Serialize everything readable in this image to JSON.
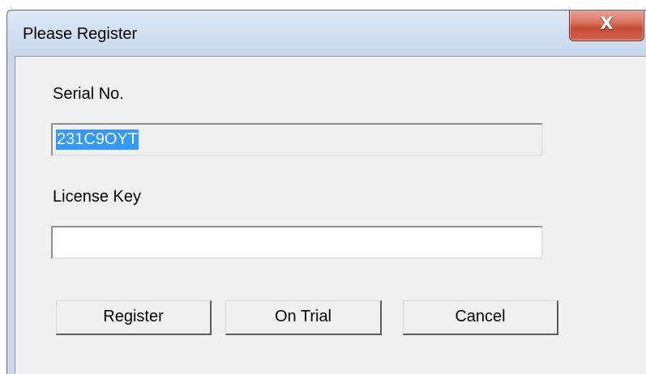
{
  "window": {
    "title": "Please Register",
    "close_symbol": "X"
  },
  "serial": {
    "label": "Serial No.",
    "value": "231C9OYT"
  },
  "license": {
    "label": "License Key",
    "value": ""
  },
  "buttons": {
    "register": "Register",
    "trial": "On Trial",
    "cancel": "Cancel"
  },
  "icons": {
    "close": "close-icon"
  },
  "colors": {
    "selection": "#3399ff",
    "close_button": "#c54a33",
    "title_bar": "#d0dff0",
    "dialog_face": "#f0f0f0"
  }
}
